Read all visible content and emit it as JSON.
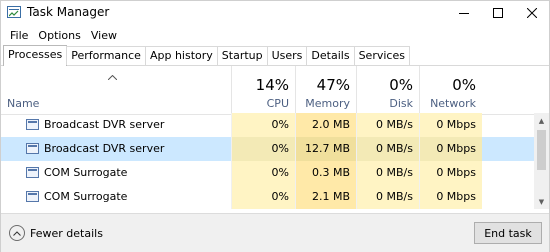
{
  "window": {
    "title": "Task Manager",
    "app_icon": "task-manager-icon",
    "controls": [
      "minimize-icon",
      "maximize-icon",
      "close-icon"
    ]
  },
  "menu": {
    "items": [
      {
        "label": "File"
      },
      {
        "label": "Options"
      },
      {
        "label": "View"
      }
    ]
  },
  "tabs": [
    {
      "label": "Processes",
      "active": true
    },
    {
      "label": "Performance"
    },
    {
      "label": "App history"
    },
    {
      "label": "Startup"
    },
    {
      "label": "Users"
    },
    {
      "label": "Details"
    },
    {
      "label": "Services"
    }
  ],
  "columns": {
    "name": {
      "label": "Name",
      "sort_icon": "sort-up-caret-icon"
    },
    "cpu": {
      "percent": "14%",
      "label": "CPU"
    },
    "memory": {
      "percent": "47%",
      "label": "Memory"
    },
    "disk": {
      "percent": "0%",
      "label": "Disk"
    },
    "network": {
      "percent": "0%",
      "label": "Network"
    }
  },
  "processes": [
    {
      "name": "Broadcast DVR server",
      "cpu": "0%",
      "memory": "2.0 MB",
      "disk": "0 MB/s",
      "network": "0 Mbps",
      "selected": false
    },
    {
      "name": "Broadcast DVR server",
      "cpu": "0%",
      "memory": "12.7 MB",
      "disk": "0 MB/s",
      "network": "0 Mbps",
      "selected": true
    },
    {
      "name": "COM Surrogate",
      "cpu": "0%",
      "memory": "0.3 MB",
      "disk": "0 MB/s",
      "network": "0 Mbps",
      "selected": false
    },
    {
      "name": "COM Surrogate",
      "cpu": "0%",
      "memory": "2.1 MB",
      "disk": "0 MB/s",
      "network": "0 Mbps",
      "selected": false
    }
  ],
  "footer": {
    "fewer_details_label": "Fewer details",
    "end_task_label": "End task"
  },
  "colors": {
    "selected_row": "#cce8ff",
    "heat_light": "#fff4c4",
    "heat_medium": "#ffe9a8",
    "header_label": "#4d6082"
  }
}
